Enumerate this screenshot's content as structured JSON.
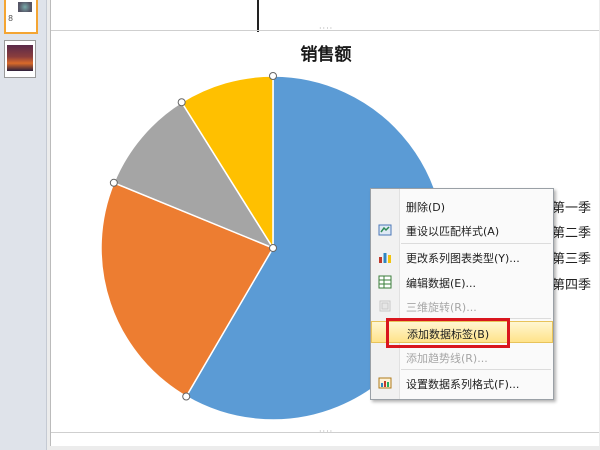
{
  "thumbnails": [
    {
      "number": "8"
    },
    {
      "number": ""
    }
  ],
  "chart_data": {
    "type": "pie",
    "title": "销售额",
    "categories": [
      "第一季度",
      "第二季度",
      "第三季度",
      "第四季度"
    ],
    "values": [
      59,
      23,
      10,
      9
    ],
    "colors": [
      "#5b9bd5",
      "#ed7d31",
      "#a5a5a5",
      "#ffc000"
    ],
    "legend_position": "right",
    "legend_visible_text": [
      "第一季",
      "第二季",
      "第三季",
      "第四季"
    ]
  },
  "context_menu": {
    "items": [
      {
        "label": "删除(D)",
        "icon": "delete-icon",
        "disabled": false
      },
      {
        "label": "重设以匹配样式(A)",
        "icon": "reset-style-icon",
        "disabled": false
      },
      {
        "label": "更改系列图表类型(Y)...",
        "icon": "chart-type-icon",
        "disabled": false
      },
      {
        "label": "编辑数据(E)...",
        "icon": "edit-data-icon",
        "disabled": false
      },
      {
        "label": "三维旋转(R)...",
        "icon": "3d-rotate-icon",
        "disabled": true
      },
      {
        "label": "添加数据标签(B)",
        "icon": "",
        "disabled": false,
        "highlighted": true
      },
      {
        "label": "添加趋势线(R)...",
        "icon": "",
        "disabled": true
      },
      {
        "label": "设置数据系列格式(F)...",
        "icon": "format-series-icon",
        "disabled": false
      }
    ]
  },
  "annotation": {
    "highlight_color": "#d9161e"
  }
}
